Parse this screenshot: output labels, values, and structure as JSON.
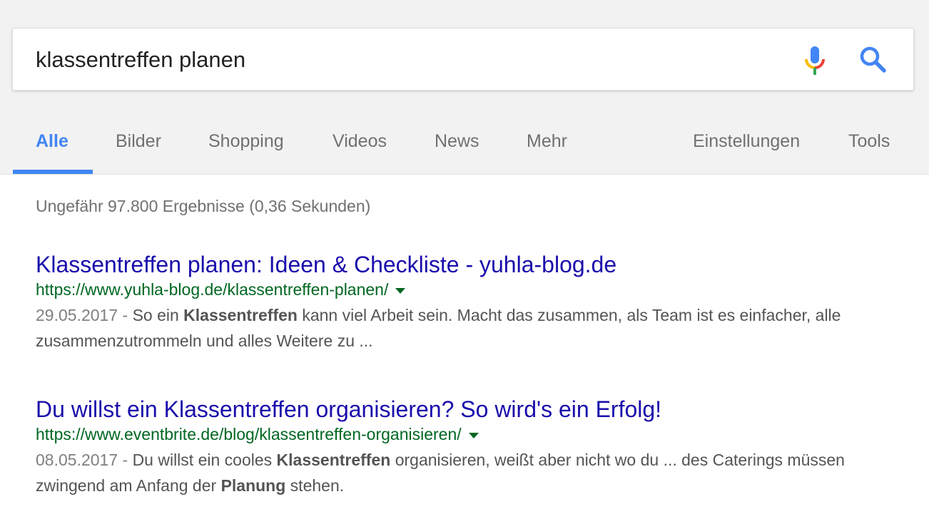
{
  "search": {
    "query": "klassentreffen planen"
  },
  "icons": {
    "mic": "microphone-icon",
    "search": "magnifier-icon"
  },
  "colors": {
    "accent": "#4285f4",
    "link": "#1a0dab",
    "url": "#006621",
    "snippet": "#545454",
    "muted": "#707070"
  },
  "tabs": [
    {
      "label": "Alle",
      "active": true
    },
    {
      "label": "Bilder"
    },
    {
      "label": "Shopping"
    },
    {
      "label": "Videos"
    },
    {
      "label": "News"
    },
    {
      "label": "Mehr"
    },
    {
      "label": "Einstellungen"
    },
    {
      "label": "Tools"
    }
  ],
  "stats": "Ungefähr 97.800 Ergebnisse (0,36 Sekunden)",
  "results": [
    {
      "title": "Klassentreffen planen: Ideen & Checkliste - yuhla-blog.de",
      "url": "https://www.yuhla-blog.de/klassentreffen-planen/",
      "date": "29.05.2017 -",
      "snippet": [
        {
          "text": "So ein "
        },
        {
          "text": "Klassentreffen",
          "bold": true
        },
        {
          "text": " kann viel Arbeit sein. Macht das zusammen, als Team ist es einfacher, alle zusammenzutrommeln und alles Weitere zu ..."
        }
      ]
    },
    {
      "title": "Du willst ein Klassentreffen organisieren? So wird's ein Erfolg!",
      "url": "https://www.eventbrite.de/blog/klassentreffen-organisieren/",
      "date": "08.05.2017 -",
      "snippet": [
        {
          "text": "Du willst ein cooles "
        },
        {
          "text": "Klassentreffen",
          "bold": true
        },
        {
          "text": " organisieren, weißt aber nicht wo du ... des Caterings müssen zwingend am Anfang der "
        },
        {
          "text": "Planung",
          "bold": true
        },
        {
          "text": " stehen."
        }
      ]
    }
  ]
}
